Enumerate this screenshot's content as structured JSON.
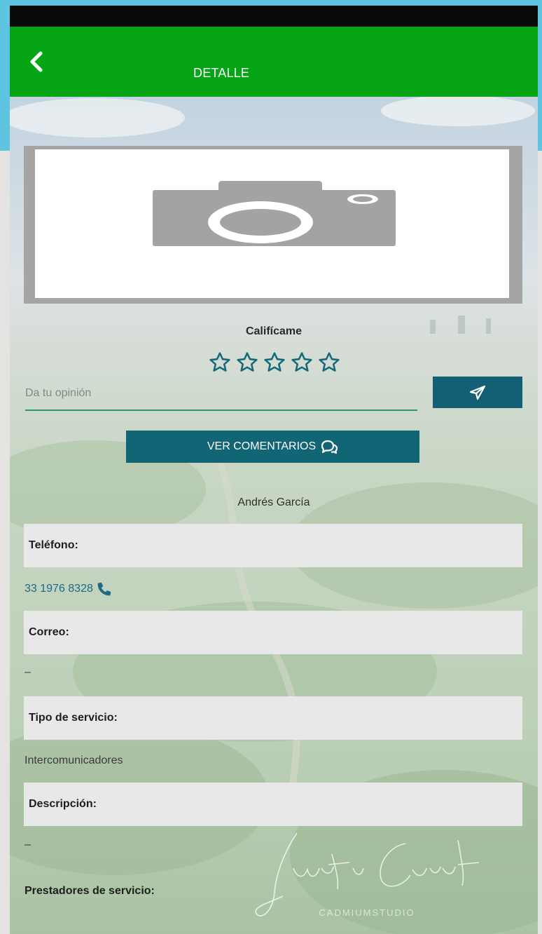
{
  "app_bar": {
    "title": "DETALLE"
  },
  "icons": {
    "back": "chevron-left-icon",
    "photo_placeholder": "camera-icon",
    "send": "paper-plane-icon",
    "comments": "comments-icon",
    "phone": "phone-icon",
    "star": "star-outline-icon"
  },
  "rating": {
    "label": "Califícame",
    "stars_total": 5,
    "stars_selected": 0
  },
  "opinion": {
    "placeholder": "Da tu opinión",
    "value": ""
  },
  "comments_button": {
    "label": "VER COMENTARIOS"
  },
  "provider": {
    "name": "Andrés García"
  },
  "fields": {
    "phone": {
      "label": "Teléfono:",
      "value": "33 1976 8328"
    },
    "email": {
      "label": "Correo:",
      "value": "–"
    },
    "service_type": {
      "label": "Tipo de servicio:",
      "value": "Intercomunicadores"
    },
    "description": {
      "label": "Descripción:",
      "value": "–"
    },
    "providers": {
      "label": "Prestadores de servicio:"
    }
  },
  "watermark": {
    "text": "Justo Correl",
    "studio": "CADMIUMSTUDIO"
  },
  "colors": {
    "app_bar": "#06a515",
    "button": "#126575",
    "frame": "#5ec5e0",
    "link": "#1b6b86"
  }
}
